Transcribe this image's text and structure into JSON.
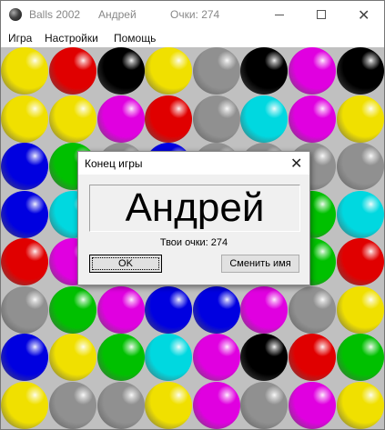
{
  "window": {
    "app_title": "Balls 2002",
    "player_name": "Андрей",
    "score_text": "Очки: 274",
    "icon": "ball-icon"
  },
  "menu": {
    "items": [
      "Игра",
      "Настройки",
      "Помощь"
    ]
  },
  "board": {
    "columns": 8,
    "rows": 8,
    "colors": {
      "yellow": "#f0e000",
      "red": "#e00000",
      "black": "#000000",
      "gray": "#909090",
      "magenta": "#e000e0",
      "blue": "#0000e0",
      "green": "#00c000",
      "cyan": "#00d8e0"
    },
    "grid": [
      [
        "yellow",
        "red",
        "black",
        "yellow",
        "gray",
        "black",
        "magenta",
        "black"
      ],
      [
        "yellow",
        "yellow",
        "magenta",
        "red",
        "gray",
        "cyan",
        "magenta",
        "yellow"
      ],
      [
        "blue",
        "green",
        "gray",
        "blue",
        "gray",
        "gray",
        "gray",
        "gray"
      ],
      [
        "blue",
        "cyan",
        "green",
        "gray",
        "gray",
        "cyan",
        "green",
        "cyan"
      ],
      [
        "red",
        "magenta",
        "red",
        "magenta",
        "gray",
        "gray",
        "green",
        "red"
      ],
      [
        "gray",
        "green",
        "magenta",
        "blue",
        "blue",
        "magenta",
        "gray",
        "yellow"
      ],
      [
        "blue",
        "yellow",
        "green",
        "cyan",
        "magenta",
        "black",
        "red",
        "green"
      ],
      [
        "yellow",
        "gray",
        "gray",
        "yellow",
        "magenta",
        "gray",
        "magenta",
        "yellow"
      ]
    ]
  },
  "dialog": {
    "title": "Конец игры",
    "player_name": "Андрей",
    "score_line": "Твои очки: 274",
    "ok_label": "OK",
    "rename_label": "Сменить имя"
  }
}
